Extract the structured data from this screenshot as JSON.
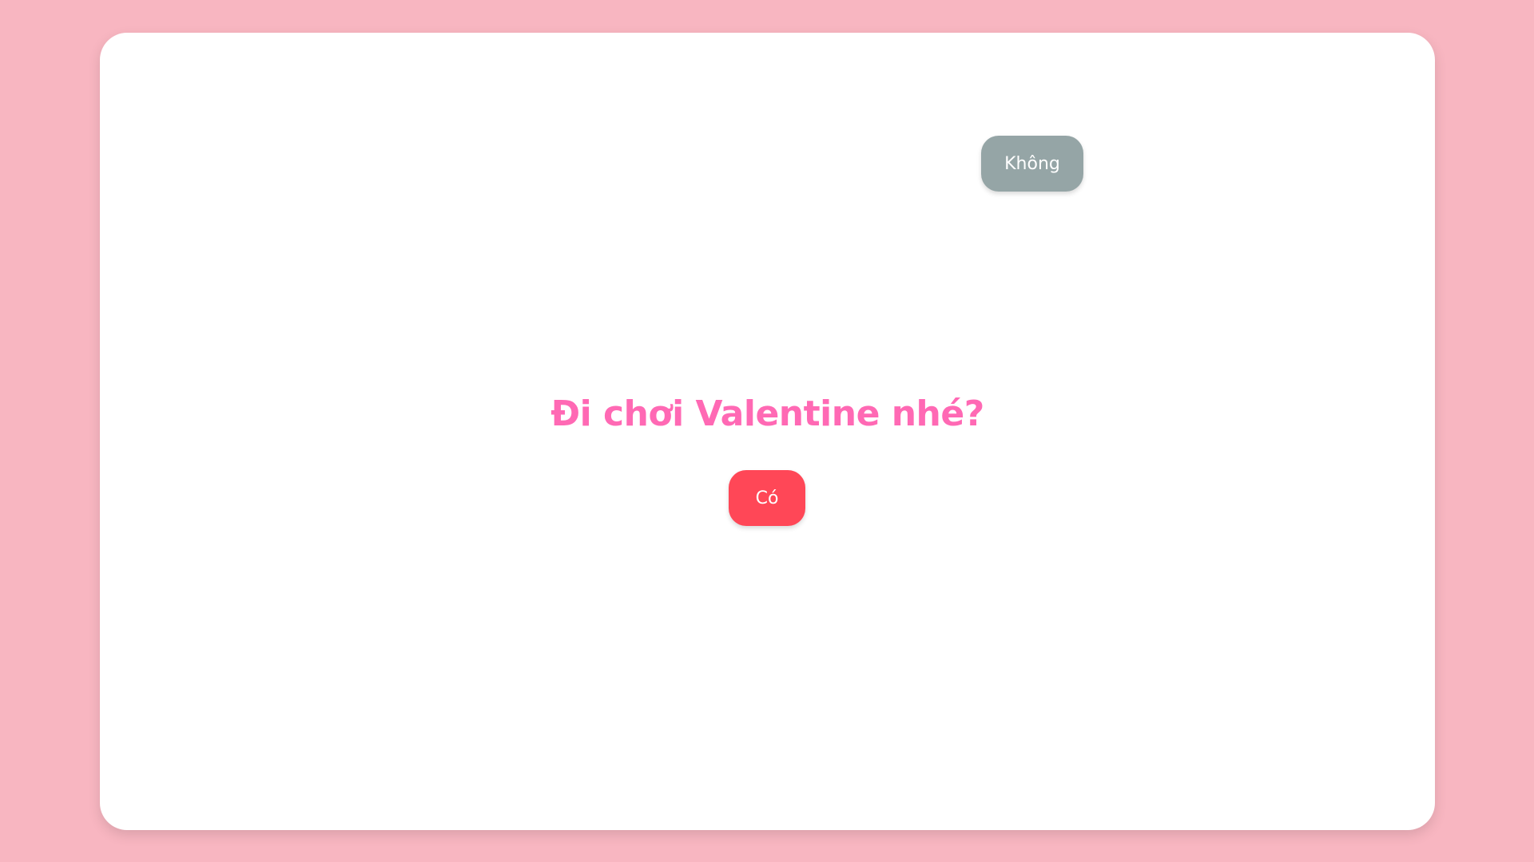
{
  "question": "Đi chơi Valentine nhé?",
  "buttons": {
    "yes_label": "Có",
    "no_label": "Không"
  },
  "colors": {
    "background": "#f8b6c1",
    "card": "#ffffff",
    "question_text": "#ff69b4",
    "yes_button": "#ff4757",
    "no_button": "#95a5a6"
  }
}
